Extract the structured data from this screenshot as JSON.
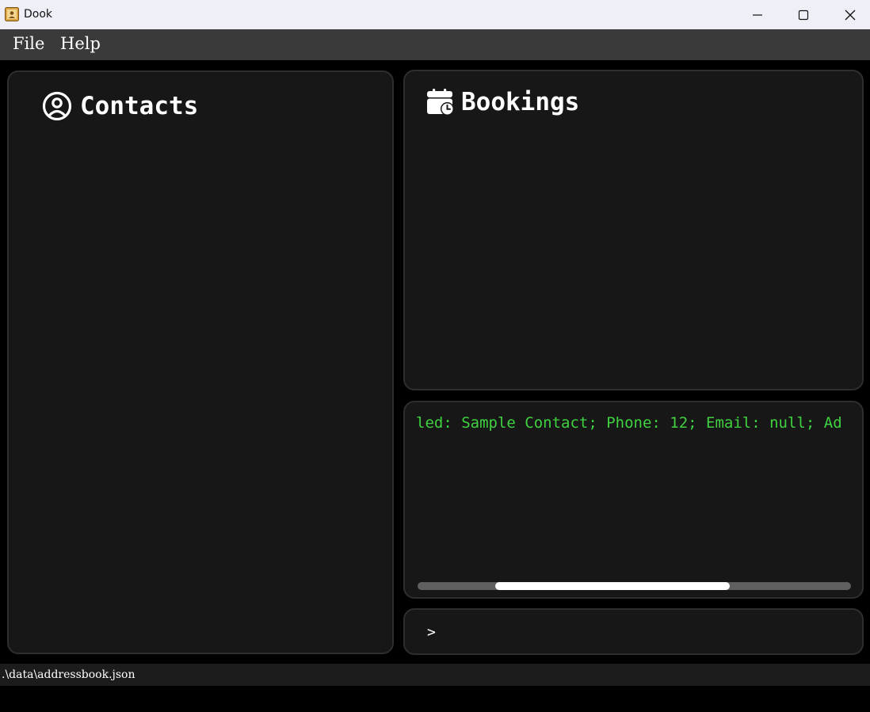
{
  "window": {
    "title": "Dook",
    "icon": "addressbook-app-icon",
    "controls": [
      "minimize-icon",
      "maximize-icon",
      "close-icon"
    ]
  },
  "menu": {
    "file_label": "File",
    "help_label": "Help"
  },
  "contacts": {
    "title": "Contacts",
    "icon": "user-circle-icon"
  },
  "bookings": {
    "title": "Bookings",
    "icon": "calendar-clock-icon"
  },
  "result": {
    "text": "led: Sample Contact; Phone: 12; Email: null; Ad",
    "scroll_position": 0.18,
    "scroll_visible_fraction": 0.54
  },
  "command": {
    "prompt": ">",
    "value": ""
  },
  "status": {
    "file_path": ".\\data\\addressbook.json"
  },
  "colors": {
    "background": "#000000",
    "panel": "#171717",
    "panel_border": "#2e2e2e",
    "menubar": "#3a3a3a",
    "result_text": "#3fd13f",
    "titlebar": "#eff0f7"
  }
}
